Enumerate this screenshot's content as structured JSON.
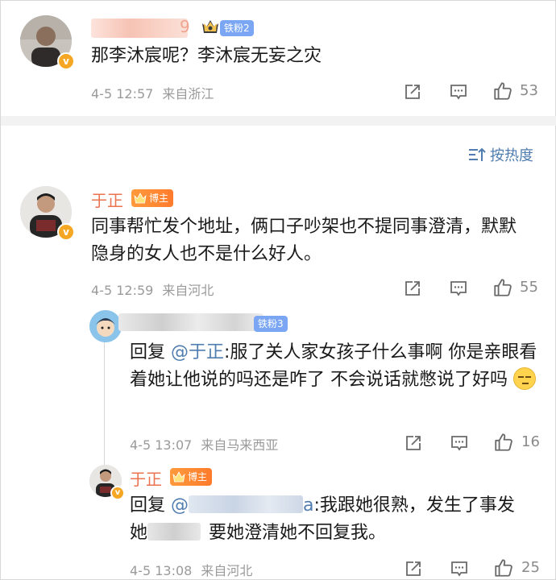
{
  "comments": [
    {
      "username_visible": "9",
      "fan_badge": "铁粉2",
      "text": "那李沐宸呢？李沐宸无妄之灾",
      "time": "4-5 12:57",
      "location": "来自浙江",
      "likes": "53"
    }
  ],
  "sort": {
    "label": "按热度"
  },
  "main_comment": {
    "username": "于正",
    "badge": "博主",
    "text": "同事帮忙发个地址，俩口子吵架也不提同事澄清，默默隐身的女人也不是什么好人。",
    "time": "4-5 12:59",
    "location": "来自河北",
    "likes": "55"
  },
  "replies": [
    {
      "fan_badge": "铁粉3",
      "reply_prefix": "回复 ",
      "mention": "@于正",
      "text": ":服了关人家女孩子什么事啊 你是亲眼看着她让他说的吗还是咋了 不会说话就憋说了好吗",
      "time": "4-5 13:07",
      "location": "来自马来西亚",
      "likes": "16"
    },
    {
      "username": "于正",
      "badge": "博主",
      "reply_prefix": "回复 ",
      "mention_start": "@",
      "mention_end": "a",
      "text_line1": ":我跟她很熟，发生了事发",
      "text_line2_start": "她",
      "text_line2_end": "要她澄清她不回复我。",
      "time": "4-5 13:08",
      "location": "来自河北",
      "likes": "25"
    }
  ],
  "colors": {
    "username": "#eb7350",
    "mention": "#507daf",
    "meta": "#9a9a9a",
    "divider": "#f2f2f2",
    "fan_badge": "#7aa6f4",
    "bozhu_badge": "#ff8a33"
  },
  "icons": [
    "share-icon",
    "comment-icon",
    "like-icon",
    "sort-icon",
    "crown-icon",
    "verified-icon",
    "emoji-icon"
  ]
}
